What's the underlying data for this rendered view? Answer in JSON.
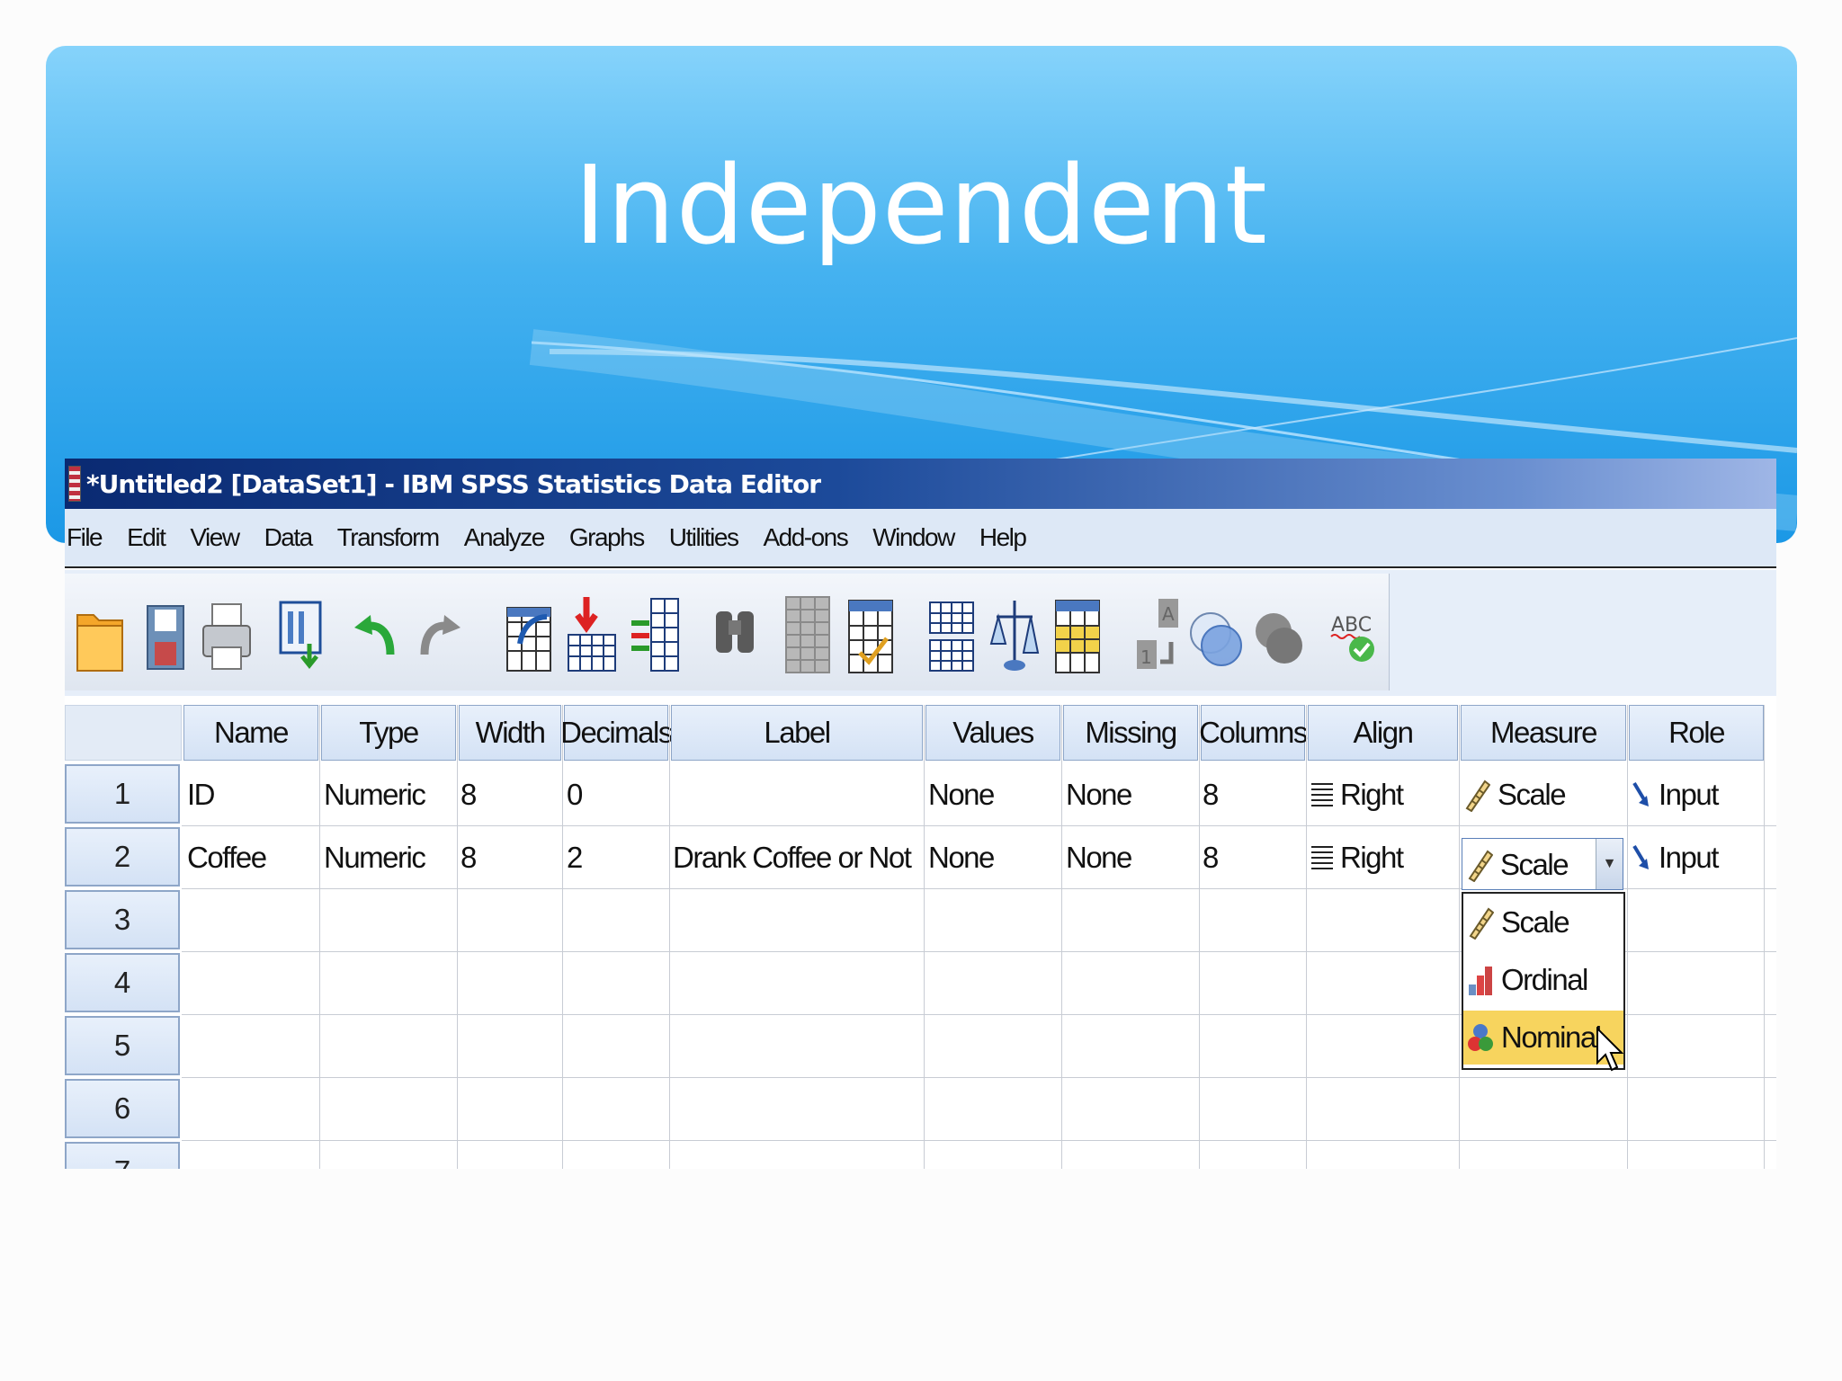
{
  "slide": {
    "title": "Independent"
  },
  "window": {
    "title": "*Untitled2 [DataSet1] - IBM SPSS Statistics Data Editor"
  },
  "menu": [
    "File",
    "Edit",
    "View",
    "Data",
    "Transform",
    "Analyze",
    "Graphs",
    "Utilities",
    "Add-ons",
    "Window",
    "Help"
  ],
  "toolbar": {
    "icons": [
      "open-folder-icon",
      "save-icon",
      "print-icon",
      "recall-dialog-icon",
      "undo-icon",
      "redo-icon",
      "goto-case-icon",
      "goto-variable-icon",
      "variables-icon",
      "find-icon",
      "insert-cases-icon",
      "insert-variable-icon",
      "split-file-icon",
      "weight-cases-icon",
      "select-cases-icon",
      "value-labels-icon",
      "use-sets-icon",
      "show-all-variables-icon",
      "spell-check-icon"
    ],
    "spell_label": "ABC"
  },
  "grid": {
    "columns": [
      "Name",
      "Type",
      "Width",
      "Decimals",
      "Label",
      "Values",
      "Missing",
      "Columns",
      "Align",
      "Measure",
      "Role"
    ],
    "row_numbers": [
      "1",
      "2",
      "3",
      "4",
      "5",
      "6",
      "7"
    ],
    "rows": [
      {
        "name": "ID",
        "type": "Numeric",
        "width": "8",
        "decimals": "0",
        "label": "",
        "values": "None",
        "missing": "None",
        "columns": "8",
        "align": "Right",
        "measure": "Scale",
        "role": "Input"
      },
      {
        "name": "Coffee",
        "type": "Numeric",
        "width": "8",
        "decimals": "2",
        "label": "Drank Coffee or Not",
        "values": "None",
        "missing": "None",
        "columns": "8",
        "align": "Right",
        "measure": "Scale",
        "role": "Input"
      }
    ]
  },
  "measure_dropdown": {
    "current": "Scale",
    "options": [
      "Scale",
      "Ordinal",
      "Nominal"
    ],
    "highlighted": "Nominal"
  },
  "colors": {
    "highlight": "#f7d45e",
    "title_bar": "#1c4a9a",
    "band": "#45b2f0"
  }
}
